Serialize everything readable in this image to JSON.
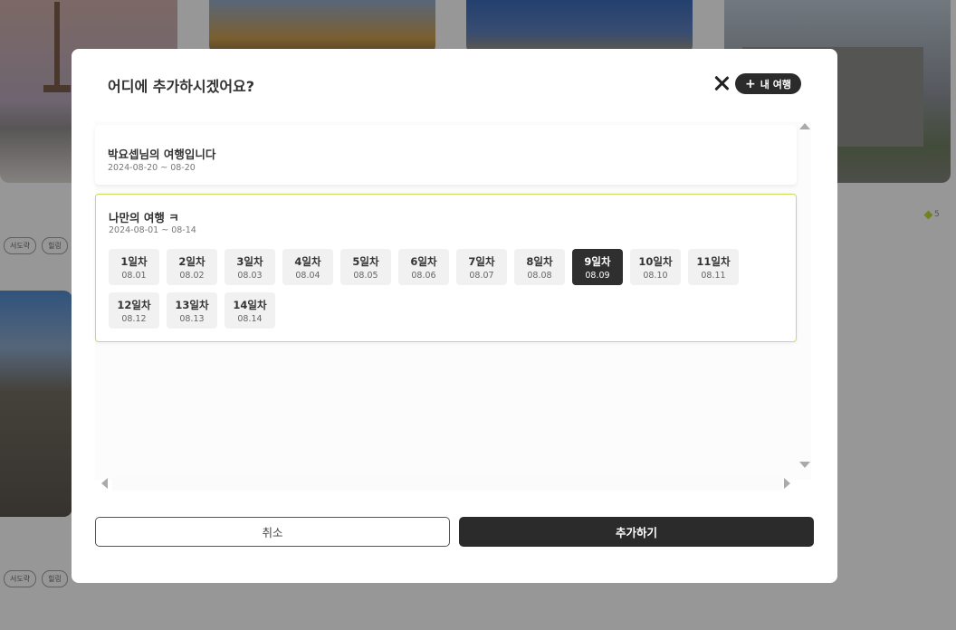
{
  "background": {
    "tags_row1": [
      "서도락",
      "힐링"
    ],
    "tags_row2": [
      "서도락",
      "힐링"
    ],
    "rating_value": "5"
  },
  "modal": {
    "title": "어디에 추가하시겠어요?",
    "my_trip_button": "내 여행",
    "trips": [
      {
        "name": "박요셉님의 여행입니다",
        "dates": "2024-08-20 ~ 08-20"
      },
      {
        "name": "나만의 여행 ㅋ",
        "dates": "2024-08-01 ~ 08-14"
      }
    ],
    "days": [
      {
        "label": "1일차",
        "date": "08.01"
      },
      {
        "label": "2일차",
        "date": "08.02"
      },
      {
        "label": "3일차",
        "date": "08.03"
      },
      {
        "label": "4일차",
        "date": "08.04"
      },
      {
        "label": "5일차",
        "date": "08.05"
      },
      {
        "label": "6일차",
        "date": "08.06"
      },
      {
        "label": "7일차",
        "date": "08.07"
      },
      {
        "label": "8일차",
        "date": "08.08"
      },
      {
        "label": "9일차",
        "date": "08.09"
      },
      {
        "label": "10일차",
        "date": "08.10"
      },
      {
        "label": "11일차",
        "date": "08.11"
      },
      {
        "label": "12일차",
        "date": "08.12"
      },
      {
        "label": "13일차",
        "date": "08.13"
      },
      {
        "label": "14일차",
        "date": "08.14"
      }
    ],
    "selected_day": "9일차",
    "cancel_button": "취소",
    "add_button": "추가하기"
  },
  "colors": {
    "accent_border": "#c6e05a",
    "dark_button": "#2b2b2b",
    "rating_icon": "#b5d334"
  }
}
